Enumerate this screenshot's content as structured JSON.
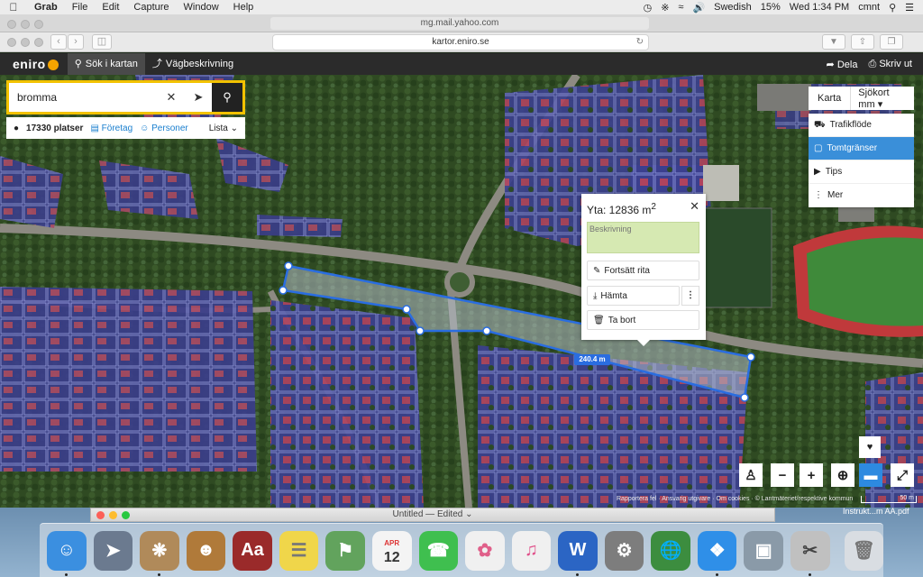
{
  "menubar": {
    "app": "Grab",
    "menus": [
      "File",
      "Edit",
      "Capture",
      "Window",
      "Help"
    ],
    "right": {
      "keyboard": "Swedish",
      "battery": "15%",
      "datetime": "Wed 1:34 PM",
      "user": "cmnt"
    }
  },
  "browser": {
    "back_tab_url": "mg.mail.yahoo.com",
    "url": "kartor.eniro.se"
  },
  "eniro": {
    "logo": "eniro",
    "tabs": [
      "Sök i kartan",
      "Vägbeskrivning"
    ],
    "share": "Dela",
    "print": "Skriv ut"
  },
  "search": {
    "value": "bromma",
    "results_count": "17330 platser",
    "companies": "Företag",
    "persons": "Personer",
    "list": "Lista"
  },
  "layers": {
    "map": "Karta",
    "sea_chart": "Sjökort mm",
    "items": [
      {
        "label": "Trafikflöde",
        "icon": "car-icon"
      },
      {
        "label": "Tomtgränser",
        "icon": "property-icon"
      },
      {
        "label": "Tips",
        "icon": "megaphone-icon"
      },
      {
        "label": "Mer",
        "icon": "more-icon"
      }
    ]
  },
  "popup": {
    "title": "Yta: 12836 m",
    "title_sup": "2",
    "description_placeholder": "Beskrivning",
    "continue": "Fortsätt rita",
    "download": "Hämta",
    "delete": "Ta bort"
  },
  "measure_label": "240.4 m",
  "attribution": "Rapportera fel · Ansvarig utgivare · Om cookies · © Lantmäteriet/respektive kommun",
  "scale": "50 m",
  "second_window": {
    "title": "Untitled — Edited"
  },
  "pdf_label": "Instrukt...m AA.pdf",
  "dock": {
    "apps": [
      {
        "name": "finder-icon",
        "color": "#3b8fe0"
      },
      {
        "name": "launchpad-icon",
        "color": "#6b7a8f"
      },
      {
        "name": "preview-icon",
        "color": "#b08a5a"
      },
      {
        "name": "contacts-icon",
        "color": "#b07a3a"
      },
      {
        "name": "dictionary-icon",
        "color": "#9a2a2a"
      },
      {
        "name": "notes-icon",
        "color": "#f0d64a"
      },
      {
        "name": "maps-icon",
        "color": "#62a35d"
      },
      {
        "name": "calendar-icon",
        "color": "#f4f4f4"
      },
      {
        "name": "facetime-icon",
        "color": "#3fbf4f"
      },
      {
        "name": "photos-icon",
        "color": "#f0f0f0"
      },
      {
        "name": "itunes-icon",
        "color": "#f0f0f0"
      },
      {
        "name": "word-icon",
        "color": "#2b65c4"
      },
      {
        "name": "system-preferences-icon",
        "color": "#7d7d7d"
      },
      {
        "name": "network-icon",
        "color": "#3c8d3f"
      },
      {
        "name": "safari-icon",
        "color": "#2f8fe8"
      },
      {
        "name": "image-capture-icon",
        "color": "#8a9aa8"
      },
      {
        "name": "grab-icon",
        "color": "#c0c0c0"
      },
      {
        "name": "trash-icon",
        "color": "#d9dde2"
      }
    ],
    "calendar_month": "APR",
    "calendar_day": "12"
  }
}
